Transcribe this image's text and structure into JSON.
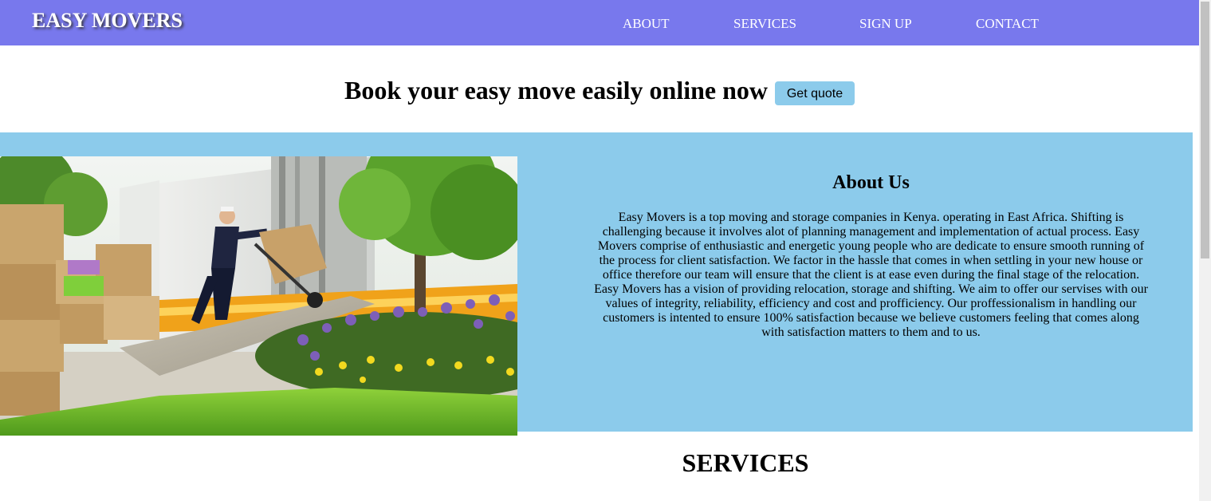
{
  "header": {
    "brand": "EASY MOVERS",
    "nav": {
      "about": "ABOUT",
      "services": "SERVICES",
      "signup": "SIGN UP",
      "contact": "CONTACT"
    }
  },
  "hero": {
    "title": "Book your easy move easily online now",
    "quote_button": "Get quote"
  },
  "about": {
    "heading": "About Us",
    "body": "Easy Movers is a top moving and storage companies in Kenya. operating in East Africa. Shifting is challenging because it involves alot of planning management and implementation of actual process. Easy Movers comprise of enthusiastic and energetic young people who are dedicate to ensure smooth running of the process for client satisfaction. We factor in the hassle that comes in when settling in your new house or office therefore our team will ensure that the client is at ease even during the final stage of the relocation. Easy Movers has a vision of providing relocation, storage and shifting. We aim to offer our servises with our values of integrity, reliability, efficiency and cost and profficiency. Our proffessionalism in handling our customers is intented to ensure 100% satisfaction because we believe customers feeling that comes along with satisfaction matters to them and to us."
  },
  "services": {
    "heading": "SERVICES"
  },
  "colors": {
    "navbar": "#7878ed",
    "accent_blue": "#8ccbeb"
  }
}
